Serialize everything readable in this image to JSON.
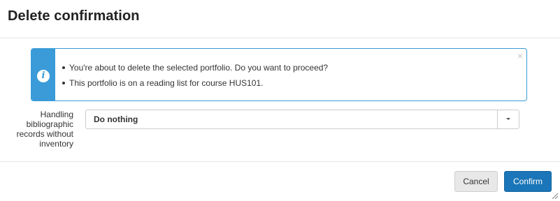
{
  "dialog": {
    "title": "Delete confirmation"
  },
  "alert": {
    "icon": "info-icon",
    "icon_glyph": "i",
    "close_glyph": "×",
    "color": "#3a9bd8",
    "messages": [
      "You're about to delete the selected portfolio. Do you want to proceed?",
      "This portfolio is on a reading list for course HUS101."
    ]
  },
  "field": {
    "label": "Handling bibliographic records without inventory",
    "selected_value": "Do nothing"
  },
  "buttons": {
    "cancel_label": "Cancel",
    "confirm_label": "Confirm",
    "confirm_color": "#1a76b8"
  }
}
